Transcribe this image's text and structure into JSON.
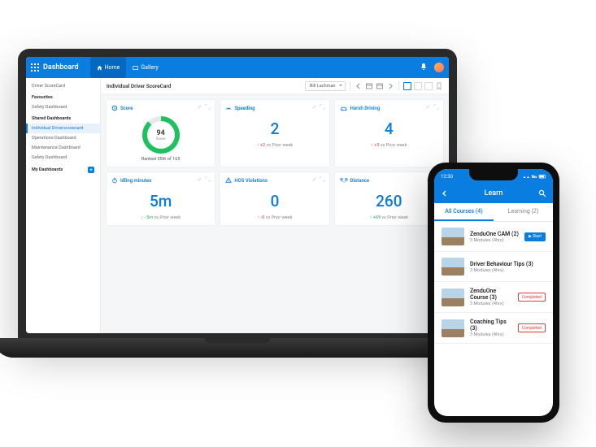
{
  "desktop": {
    "app_title": "Dashboard",
    "tabs": {
      "home": "Home",
      "gallery": "Gallery"
    },
    "sidebar": {
      "scorecard": "Driver ScoreCard",
      "favourites": "Favourites",
      "items_fav": [
        "Safety Dashboard"
      ],
      "shared": "Shared Dashboards",
      "items_shared": [
        "Individual Driverscorecard",
        "Operations Dashboard",
        "Maintenance Dashboard",
        "Safety Dashboard"
      ],
      "mine": "My Dashboards"
    },
    "crumb": {
      "title": "Individual Driver ScoreCard",
      "user": "Bill Lachman"
    },
    "cards": {
      "score": {
        "title": "Score",
        "value": "94",
        "value_label": "Score",
        "rank": "Ranked 55th of 165"
      },
      "speeding": {
        "title": "Speeding",
        "value": "2",
        "delta": "+2",
        "suffix": "vs Prior week"
      },
      "harsh": {
        "title": "Harsh Driving",
        "value": "4",
        "delta": "+3",
        "suffix": "vs Prior week"
      },
      "idling": {
        "title": "Idling minutes",
        "value": "5m",
        "delta": "- 5m",
        "suffix": "vs Prior week"
      },
      "hos": {
        "title": "HOS Violations",
        "value": "0",
        "delta": "-0",
        "suffix": "vs Prior week"
      },
      "distance": {
        "title": "Distance",
        "value": "260",
        "delta": "+69",
        "suffix": "vs Prior week"
      }
    }
  },
  "phone": {
    "time": "12:30",
    "title": "Learn",
    "tabs": {
      "all": "All Courses (4)",
      "learning": "Learning (2)"
    },
    "items": [
      {
        "title": "ZenduOne CAM (2)",
        "sub": "3 Modules (4hrs)",
        "badge": "▶ Start",
        "badge_type": "start"
      },
      {
        "title": "Driver Behaviour Tips (3)",
        "sub": "3 Modules (4hrs)"
      },
      {
        "title": "ZenduOne Course (3)",
        "sub": "3 Modules (4hrs)",
        "badge": "Completed",
        "badge_type": "done"
      },
      {
        "title": "Coaching Tips (3)",
        "sub": "3 Modules (4hrs)",
        "badge": "Completed",
        "badge_type": "done"
      }
    ]
  }
}
